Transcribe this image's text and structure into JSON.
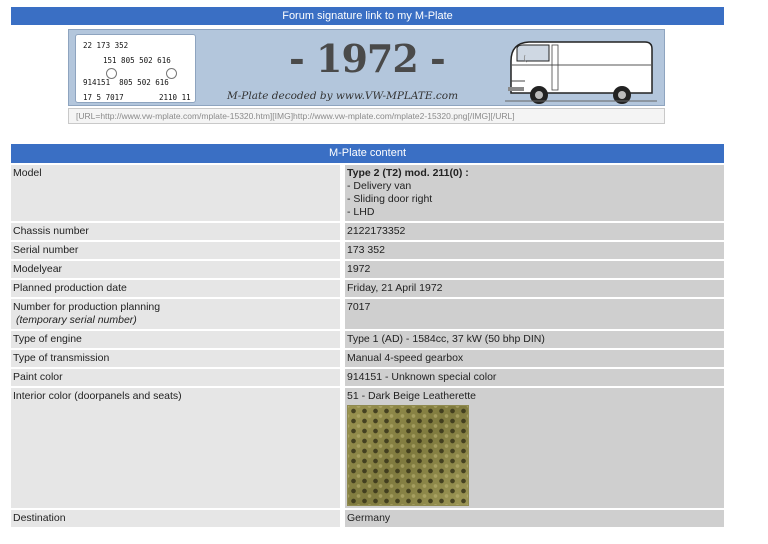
{
  "signature_header": "Forum signature link to my M-Plate",
  "banner": {
    "plate_lines": [
      "22 173 352",
      "151 805 502 616",
      "914151  805 502 616",
      "17 5 7017",
      "2110 11"
    ],
    "year": "- 1972 -",
    "decoded_text": "M-Plate decoded by www.VW-MPLATE.com"
  },
  "signature_code": "[URL=http://www.vw-mplate.com/mplate-15320.htm][IMG]http://www.vw-mplate.com/mplate2-15320.png[/IMG][/URL]",
  "content_header": "M-Plate content",
  "rows": {
    "model": {
      "label": "Model",
      "value": "Type 2 (T2) mod. 211(0) :",
      "details": [
        "- Delivery van",
        "- Sliding door right",
        "- LHD"
      ]
    },
    "chassis": {
      "label": "Chassis number",
      "value": "2122173352"
    },
    "serial": {
      "label": "Serial number",
      "value": "173 352"
    },
    "modelyear": {
      "label": "Modelyear",
      "value": "1972"
    },
    "planned": {
      "label": "Planned production date",
      "value": "Friday, 21 April 1972"
    },
    "planning": {
      "label": "Number for production planning",
      "sublabel": "(temporary serial number)",
      "value": "7017"
    },
    "engine": {
      "label": "Type of engine",
      "value": "Type 1 (AD) - 1584cc, 37 kW (50 bhp DIN)"
    },
    "transmission": {
      "label": "Type of transmission",
      "value": "Manual 4-speed gearbox"
    },
    "paint": {
      "label": "Paint color",
      "value": "914151 - Unknown special color"
    },
    "interior": {
      "label": "Interior color (doorpanels and seats)",
      "value": "51 - Dark Beige Leatherette"
    },
    "destination": {
      "label": "Destination",
      "value": "Germany"
    }
  }
}
